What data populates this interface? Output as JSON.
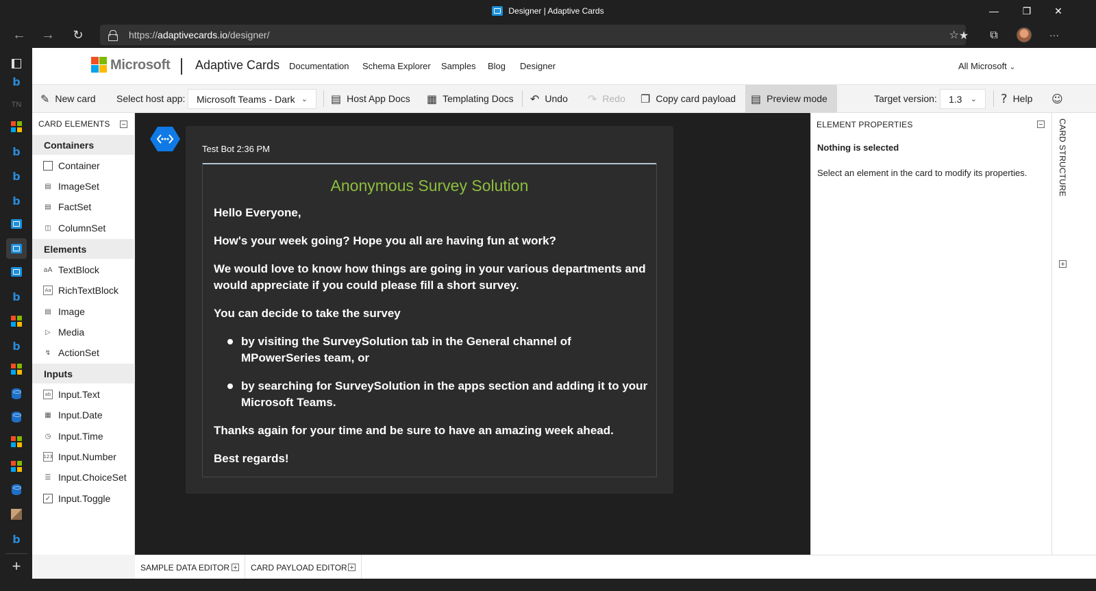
{
  "browser": {
    "tab_title": "Designer | Adaptive Cards",
    "url_scheme": "https://",
    "url_host": "adaptivecards.io",
    "url_path": "/designer/"
  },
  "site_header": {
    "ms_brand": "Microsoft",
    "brand": "Adaptive Cards",
    "nav": [
      "Documentation",
      "Schema Explorer",
      "Samples",
      "Blog",
      "Designer"
    ],
    "all_microsoft": "All Microsoft"
  },
  "toolbar": {
    "new_card": "New card",
    "select_host_label": "Select host app:",
    "host_app_value": "Microsoft Teams - Dark",
    "host_app_docs": "Host App Docs",
    "templating_docs": "Templating Docs",
    "undo": "Undo",
    "redo": "Redo",
    "copy_payload": "Copy card payload",
    "preview_mode": "Preview mode",
    "target_version_label": "Target version:",
    "target_version_value": "1.3",
    "help": "Help"
  },
  "card_elements": {
    "header": "CARD ELEMENTS",
    "containers_label": "Containers",
    "containers": [
      "Container",
      "ImageSet",
      "FactSet",
      "ColumnSet"
    ],
    "elements_label": "Elements",
    "elements": [
      "TextBlock",
      "RichTextBlock",
      "Image",
      "Media",
      "ActionSet"
    ],
    "inputs_label": "Inputs",
    "inputs": [
      "Input.Text",
      "Input.Date",
      "Input.Time",
      "Input.Number",
      "Input.ChoiceSet",
      "Input.Toggle"
    ]
  },
  "preview": {
    "sender": "Test Bot 2:36 PM",
    "card_title": "Anonymous Survey Solution",
    "title_color": "#8bbf3e",
    "p1": "Hello Everyone,",
    "p2": "How's your week going? Hope you all are having fun at work?",
    "p3a": "We would love to know how things are going in your various departments and",
    "p3b": "would appreciate if you could please fill a short survey.",
    "p4": "You can decide to take the survey",
    "b1a": "by visiting the SurveySolution tab in the General channel of",
    "b1b": "MPowerSeries team, or",
    "b2a": "by searching for SurveySolution in the apps section and adding it to your",
    "b2b": "Microsoft Teams.",
    "p5": "Thanks again for your time and be sure to have an amazing week ahead.",
    "p6": "Best regards!"
  },
  "element_properties": {
    "header": "ELEMENT PROPERTIES",
    "title": "Nothing is selected",
    "description": "Select an element in the card to modify its properties."
  },
  "card_structure": {
    "label": "CARD STRUCTURE"
  },
  "bottom": {
    "sample_data_editor": "SAMPLE DATA EDITOR",
    "card_payload_editor": "CARD PAYLOAD EDITOR"
  },
  "icons": {
    "back": "back-arrow-icon",
    "forward": "forward-arrow-icon",
    "refresh": "refresh-icon",
    "lock": "lock-icon",
    "favorite_add": "add-favorite-icon",
    "favorites": "favorites-icon",
    "collections": "collections-icon",
    "more": "more-icon"
  }
}
